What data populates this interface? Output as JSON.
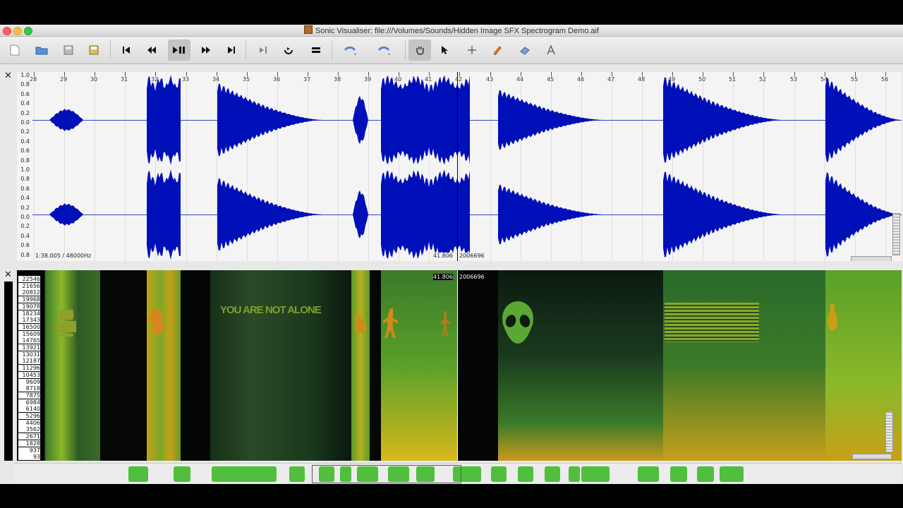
{
  "window": {
    "title": "Sonic Visualiser: file:///Volumes/Sounds/Hidden Image SFX Spectrogram Demo.aif"
  },
  "toolbar": {
    "buttons": [
      {
        "name": "new-session",
        "icon": "new-document-icon"
      },
      {
        "name": "open",
        "icon": "folder-open-icon"
      },
      {
        "name": "save",
        "icon": "disk-icon"
      },
      {
        "name": "export",
        "icon": "export-icon"
      },
      {
        "name": "rewind-start",
        "icon": "skip-back-icon"
      },
      {
        "name": "rewind",
        "icon": "rewind-icon"
      },
      {
        "name": "play-pause",
        "icon": "play-pause-icon"
      },
      {
        "name": "fast-forward",
        "icon": "fast-forward-icon"
      },
      {
        "name": "ffwd-end",
        "icon": "skip-forward-icon"
      },
      {
        "name": "play-selection",
        "icon": "play-selection-icon"
      },
      {
        "name": "loop",
        "icon": "loop-icon"
      },
      {
        "name": "solo",
        "icon": "solo-icon"
      },
      {
        "name": "undo",
        "icon": "undo-icon"
      },
      {
        "name": "redo",
        "icon": "redo-icon"
      },
      {
        "name": "navigate-tool",
        "icon": "hand-icon"
      },
      {
        "name": "select-tool",
        "icon": "arrow-cursor-icon"
      },
      {
        "name": "move-tool",
        "icon": "move-icon"
      },
      {
        "name": "draw-tool",
        "icon": "pencil-icon"
      },
      {
        "name": "erase-tool",
        "icon": "eraser-icon"
      },
      {
        "name": "measure-tool",
        "icon": "measure-icon"
      }
    ]
  },
  "waveform": {
    "ruler_labels": [
      "28",
      "29",
      "30",
      "31",
      "32",
      "33",
      "34",
      "35",
      "36",
      "37",
      "38",
      "39",
      "40",
      "41",
      "42",
      "43",
      "44",
      "45",
      "46",
      "47",
      "48",
      "49",
      "50",
      "51",
      "52",
      "53",
      "54",
      "55",
      "56"
    ],
    "amp_labels_top": [
      "1.0",
      "0.8",
      "0.6",
      "0.4",
      "0.2",
      "0.0",
      "0.2",
      "0.4",
      "0.6",
      "0.8"
    ],
    "amp_labels_bottom": [
      "1.0",
      "0.8",
      "0.6",
      "0.4",
      "0.2",
      "0.0",
      "0.2",
      "0.4",
      "0.6",
      "0.8"
    ],
    "position_info": "1:38.005 / 48000Hz",
    "cursor_time": "41.806",
    "cursor_frame": "2006696",
    "wave_color": "#0010b8"
  },
  "spectrogram": {
    "freq_labels": [
      "22546",
      "21656",
      "20812",
      "19968",
      "19078",
      "18234",
      "17343",
      "16500",
      "15609",
      "14765",
      "13921",
      "13031",
      "12187",
      "11296",
      "10453",
      "9609",
      "8718",
      "7875",
      "6984",
      "6140",
      "5296",
      "4406",
      "3562",
      "2671",
      "1828",
      "937",
      "93"
    ],
    "hidden_text": "YOU ARE NOT ALONE",
    "cursor_time": "41.806",
    "cursor_frame": "2006696"
  },
  "overview": {
    "color": "#4fbf3d"
  }
}
